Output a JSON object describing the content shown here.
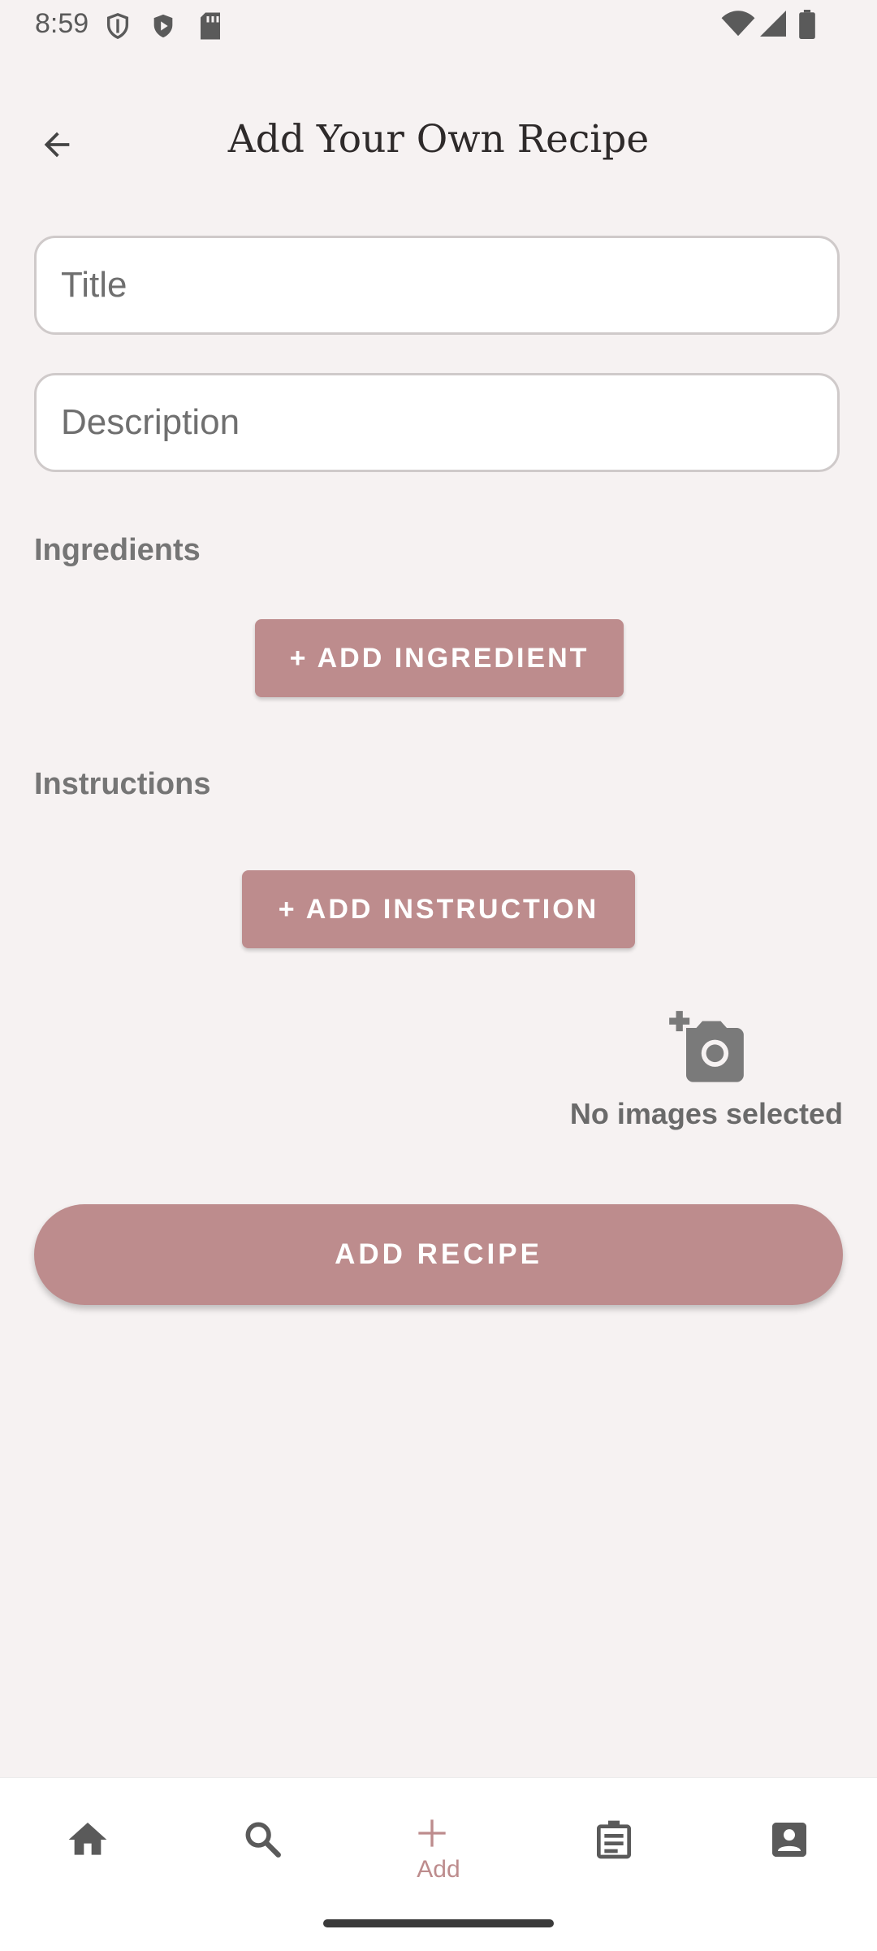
{
  "status_bar": {
    "time": "8:59",
    "left_icons": [
      "shield-outline-icon",
      "play-shield-icon",
      "sd-card-icon"
    ],
    "right_icons": [
      "wifi-icon",
      "signal-icon",
      "battery-icon"
    ]
  },
  "app_bar": {
    "back_icon": "arrow-back-icon",
    "title": "Add Your Own Recipe"
  },
  "form": {
    "title_placeholder": "Title",
    "description_placeholder": "Description",
    "ingredients_label": "Ingredients",
    "add_ingredient_label": "+ ADD INGREDIENT",
    "instructions_label": "Instructions",
    "add_instruction_label": "+ ADD INSTRUCTION",
    "image_icon": "add-photo-icon",
    "no_images_text": "No images selected",
    "add_recipe_label": "ADD RECIPE"
  },
  "bottom_nav": {
    "items": [
      {
        "icon": "home-icon",
        "label": ""
      },
      {
        "icon": "search-icon",
        "label": ""
      },
      {
        "icon": "add-icon",
        "label": "Add",
        "active": true
      },
      {
        "icon": "clipboard-icon",
        "label": ""
      },
      {
        "icon": "account-box-icon",
        "label": ""
      }
    ]
  },
  "colors": {
    "accent": "#bd8c8d",
    "background": "#f6f2f2",
    "nav_background": "#ffffff"
  }
}
